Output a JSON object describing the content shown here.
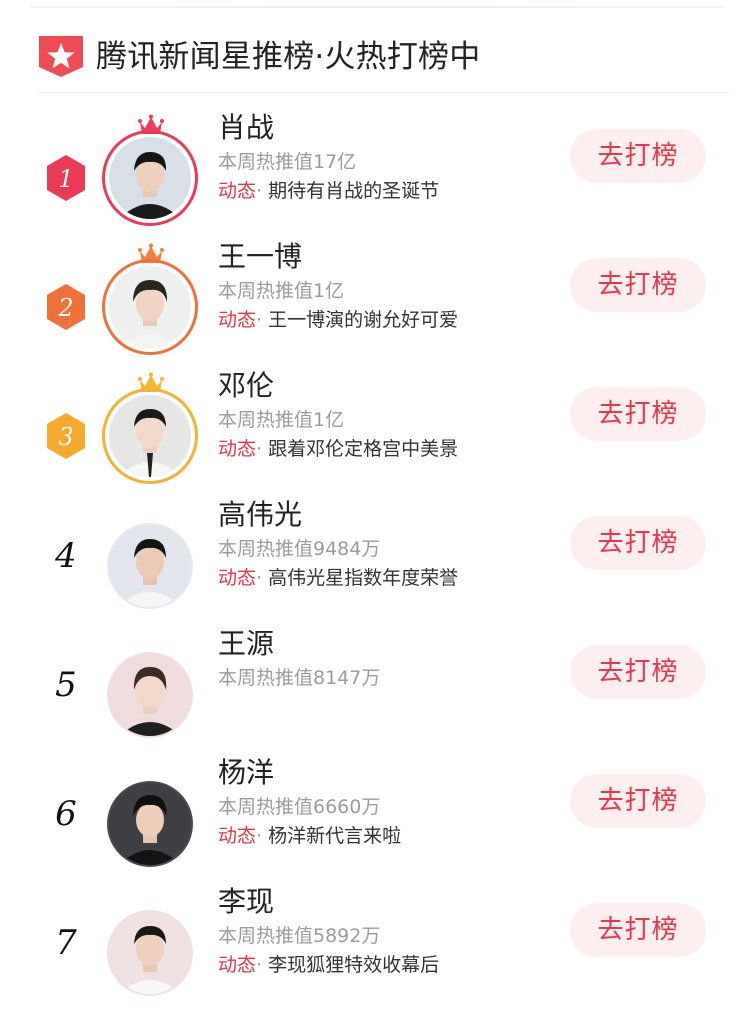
{
  "header": {
    "title": "腾讯新闻星推榜·火热打榜中",
    "badge_icon": "star-shield-icon",
    "badge_color": "#ef4b55"
  },
  "dynamic_tag": "动态",
  "dynamic_sep": "·",
  "action_label": "去打榜",
  "colors": {
    "accent": "#e8364a",
    "button_bg": "#fdeff0",
    "rank1": "#ea3a55",
    "rank2": "#f0703a",
    "rank3": "#f6a92c",
    "muted": "#9b9b9b"
  },
  "ranking": [
    {
      "rank": "1",
      "name": "肖战",
      "heat": "本周热推值17亿",
      "dynamic": "期待有肖战的圣诞节"
    },
    {
      "rank": "2",
      "name": "王一博",
      "heat": "本周热推值1亿",
      "dynamic": "王一博演的谢允好可爱"
    },
    {
      "rank": "3",
      "name": "邓伦",
      "heat": "本周热推值1亿",
      "dynamic": "跟着邓伦定格宫中美景"
    },
    {
      "rank": "4",
      "name": "高伟光",
      "heat": "本周热推值9484万",
      "dynamic": "高伟光星指数年度荣誉"
    },
    {
      "rank": "5",
      "name": "王源",
      "heat": "本周热推值8147万",
      "dynamic": ""
    },
    {
      "rank": "6",
      "name": "杨洋",
      "heat": "本周热推值6660万",
      "dynamic": "杨洋新代言来啦"
    },
    {
      "rank": "7",
      "name": "李现",
      "heat": "本周热推值5892万",
      "dynamic": "李现狐狸特效收幕后"
    }
  ]
}
